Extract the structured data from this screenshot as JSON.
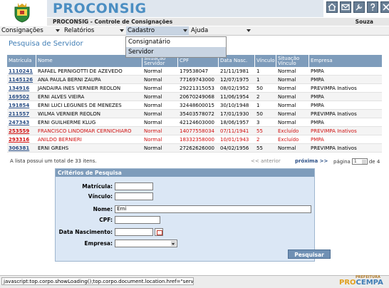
{
  "header": {
    "brand": "PROCONSIG",
    "subtitle": "PROCONSIG - Controle de Consignações",
    "user": "Souza",
    "icons": [
      "home-icon",
      "mail-icon",
      "tools-icon",
      "help-icon",
      "close-icon"
    ]
  },
  "menu": {
    "items": [
      {
        "label": "Consignações"
      },
      {
        "label": "Relatórios"
      },
      {
        "label": "Cadastro"
      },
      {
        "label": "Ajuda"
      }
    ],
    "dropdown": [
      "Consignatário",
      "Servidor"
    ]
  },
  "page": {
    "title": "Pesquisa de Servidor"
  },
  "table": {
    "headers": [
      "Matrícula",
      "Nome",
      "Situação Servidor",
      "CPF",
      "Data Nasc.",
      "Vínculo",
      "Situação Vínculo",
      "Empresa"
    ],
    "rows": [
      {
        "matricula": "1110241",
        "nome": "RAFAEL PERNIGOTTI DE AZEVEDO",
        "situacao": "Normal",
        "cpf": "179538047",
        "nasc": "21/11/1981",
        "vinculo": "1",
        "sit_vinculo": "Normal",
        "empresa": "PMPA",
        "excluido": false
      },
      {
        "matricula": "1145126",
        "nome": "ANA PAULA BERNI ZAUPA",
        "situacao": "Normal",
        "cpf": "77169743000",
        "nasc": "12/07/1975",
        "vinculo": "1",
        "sit_vinculo": "Normal",
        "empresa": "PMPA",
        "excluido": false
      },
      {
        "matricula": "134916",
        "nome": "JANDAIRA INES VERNIER REOLON",
        "situacao": "Normal",
        "cpf": "29221315053",
        "nasc": "08/02/1952",
        "vinculo": "50",
        "sit_vinculo": "Normal",
        "empresa": "PREVIMPA Inativos",
        "excluido": false
      },
      {
        "matricula": "169502",
        "nome": "ERNI ALVES VIEIRA",
        "situacao": "Normal",
        "cpf": "20670249068",
        "nasc": "11/06/1954",
        "vinculo": "2",
        "sit_vinculo": "Normal",
        "empresa": "PMPA",
        "excluido": false
      },
      {
        "matricula": "191854",
        "nome": "ERNI LUCI LEGUNES DE MENEZES",
        "situacao": "Normal",
        "cpf": "32448600015",
        "nasc": "30/10/1948",
        "vinculo": "1",
        "sit_vinculo": "Normal",
        "empresa": "PMPA",
        "excluido": false
      },
      {
        "matricula": "211557",
        "nome": "WILMA VERNIER REOLON",
        "situacao": "Normal",
        "cpf": "35403578072",
        "nasc": "17/01/1930",
        "vinculo": "50",
        "sit_vinculo": "Normal",
        "empresa": "PREVIMPA Inativos",
        "excluido": false
      },
      {
        "matricula": "247343",
        "nome": "ERNI GUILHERME KLUG",
        "situacao": "Normal",
        "cpf": "42124603000",
        "nasc": "18/06/1957",
        "vinculo": "3",
        "sit_vinculo": "Normal",
        "empresa": "PMPA",
        "excluido": false
      },
      {
        "matricula": "253559",
        "nome": "FRANCISCO LINDOMAR CERNICHIARO",
        "situacao": "Normal",
        "cpf": "14077558034",
        "nasc": "07/11/1941",
        "vinculo": "55",
        "sit_vinculo": "Excluído",
        "empresa": "PREVIMPA Inativos",
        "excluido": true
      },
      {
        "matricula": "293316",
        "nome": "ANILDO BERNIERI",
        "situacao": "Normal",
        "cpf": "18332358000",
        "nasc": "10/01/1943",
        "vinculo": "2",
        "sit_vinculo": "Excluído",
        "empresa": "PMPA",
        "excluido": true
      },
      {
        "matricula": "306381",
        "nome": "ERNI GREHS",
        "situacao": "Normal",
        "cpf": "27262626000",
        "nasc": "04/02/1956",
        "vinculo": "55",
        "sit_vinculo": "Normal",
        "empresa": "PREVIMPA Inativos",
        "excluido": false
      }
    ],
    "count_text": "A lista possui um total de 33 itens.",
    "prev": "<< anterior",
    "next": "próxima >>",
    "page_label": "página",
    "page_value": "1",
    "page_total": "de 4"
  },
  "search": {
    "title": "Critérios de Pesquisa",
    "fields": {
      "matricula": {
        "label": "Matrícula:",
        "value": ""
      },
      "vinculo": {
        "label": "Vínculo:",
        "value": ""
      },
      "nome": {
        "label": "Nome:",
        "value": "Erni"
      },
      "cpf": {
        "label": "CPF:",
        "value": ""
      },
      "nasc": {
        "label": "Data Nascimento:",
        "value": ""
      },
      "empresa": {
        "label": "Empresa:",
        "value": ""
      }
    },
    "button": "Pesquisar"
  },
  "status": {
    "text": "javascript:top.corpo.showLoading();top.corpo.document.location.href=\"serv...",
    "footer_small": "PREFEITURA",
    "footer_brand_a": "PRO",
    "footer_brand_b": "CEMPA"
  },
  "colors": {
    "brand": "#4b8ec2",
    "table_header": "#7e9cbb",
    "excluded": "#d01010"
  }
}
